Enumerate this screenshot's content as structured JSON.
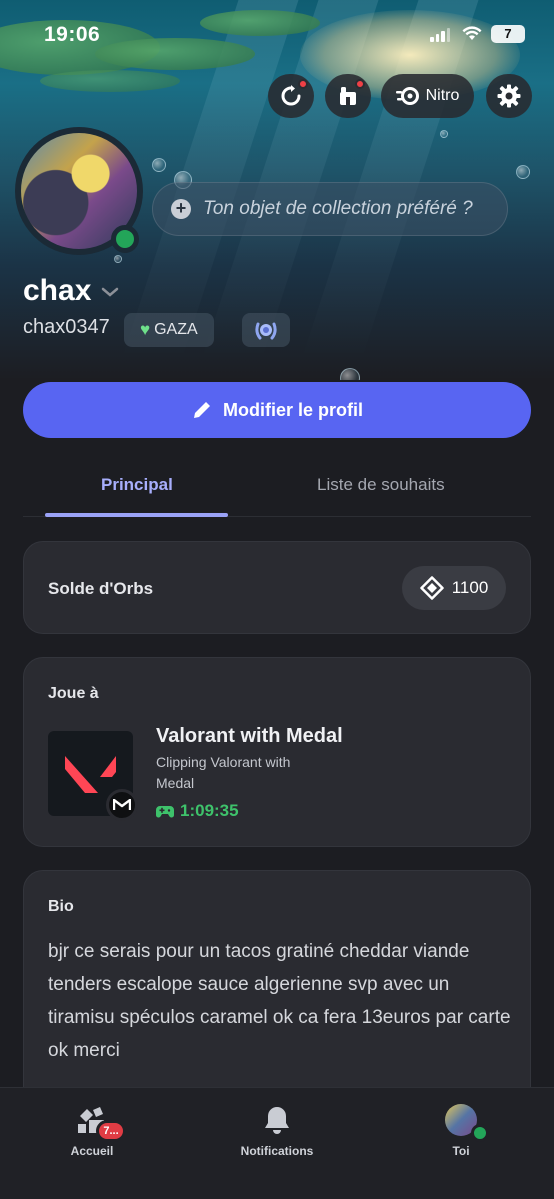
{
  "status_bar": {
    "time": "19:06",
    "battery": "7"
  },
  "header": {
    "buttons": [
      {
        "name": "refresh-icon"
      },
      {
        "name": "shop-icon"
      },
      {
        "name": "nitro",
        "label": "Nitro"
      },
      {
        "name": "settings"
      }
    ],
    "collectible_placeholder": "Ton objet de collection préféré ?"
  },
  "profile": {
    "display_name": "chax",
    "handle": "chax0347",
    "tag": "GAZA",
    "status": "online",
    "edit_label": "Modifier le profil"
  },
  "tabs": [
    {
      "label": "Principal",
      "active": true
    },
    {
      "label": "Liste de souhaits",
      "active": false
    }
  ],
  "orbs": {
    "label": "Solde d'Orbs",
    "value": "1100"
  },
  "activity": {
    "heading": "Joue à",
    "title": "Valorant with Medal",
    "subtitle": "Clipping Valorant with Medal",
    "elapsed": "1:09:35"
  },
  "bio": {
    "heading": "Bio",
    "text": "bjr ce serais pour un tacos gratiné cheddar viande tenders escalope sauce algerienne svp avec un tiramisu spéculos caramel ok ca fera 13euros par carte ok merci"
  },
  "bottom_nav": [
    {
      "label": "Accueil",
      "badge": "7..."
    },
    {
      "label": "Notifications"
    },
    {
      "label": "Toi"
    }
  ],
  "colors": {
    "accent": "#5865f2",
    "online": "#23a559",
    "badge": "#e03c44",
    "time_green": "#3ec26b"
  }
}
